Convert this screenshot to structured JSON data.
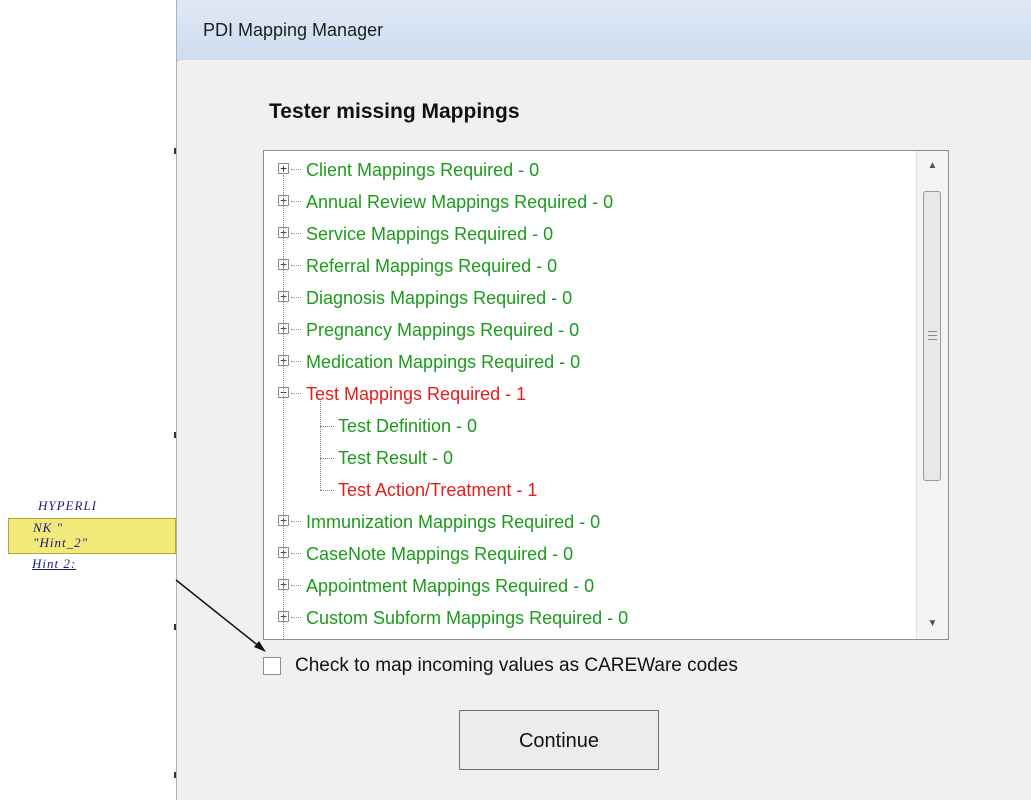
{
  "window": {
    "title": "PDI Mapping Manager"
  },
  "heading": "Tester missing Mappings",
  "tree": {
    "items": [
      {
        "label": "Client Mappings Required - 0",
        "color": "green",
        "expanded": false,
        "toggle": "+"
      },
      {
        "label": "Annual Review Mappings Required - 0",
        "color": "green",
        "expanded": false,
        "toggle": "+"
      },
      {
        "label": "Service Mappings Required - 0",
        "color": "green",
        "expanded": false,
        "toggle": "+"
      },
      {
        "label": "Referral Mappings Required - 0",
        "color": "green",
        "expanded": false,
        "toggle": "+"
      },
      {
        "label": "Diagnosis Mappings Required - 0",
        "color": "green",
        "expanded": false,
        "toggle": "+"
      },
      {
        "label": "Pregnancy Mappings Required - 0",
        "color": "green",
        "expanded": false,
        "toggle": "+"
      },
      {
        "label": "Medication Mappings Required - 0",
        "color": "green",
        "expanded": false,
        "toggle": "+"
      },
      {
        "label": "Test Mappings Required - 1",
        "color": "red",
        "expanded": true,
        "toggle": "−",
        "children": [
          {
            "label": "Test Definition - 0",
            "color": "green"
          },
          {
            "label": "Test Result - 0",
            "color": "green"
          },
          {
            "label": "Test Action/Treatment - 1",
            "color": "red"
          }
        ]
      },
      {
        "label": "Immunization Mappings Required - 0",
        "color": "green",
        "expanded": false,
        "toggle": "+"
      },
      {
        "label": "CaseNote Mappings Required - 0",
        "color": "green",
        "expanded": false,
        "toggle": "+"
      },
      {
        "label": "Appointment Mappings Required - 0",
        "color": "green",
        "expanded": false,
        "toggle": "+"
      },
      {
        "label": "Custom Subform Mappings Required - 0",
        "color": "green",
        "expanded": false,
        "toggle": "+"
      }
    ],
    "scrollbar": {
      "up_glyph": "▲",
      "down_glyph": "▼"
    }
  },
  "checkbox": {
    "label": "Check to map incoming values as CAREWare codes",
    "checked": false
  },
  "continue_button": {
    "label": "Continue"
  },
  "callout": {
    "line1": "HYPERLI",
    "line2": "NK  \"",
    "line3": "\"Hint_2\"",
    "line4": "Hint 2:"
  },
  "colors": {
    "green": "#1c9a1c",
    "red": "#e21d1d",
    "titlebar": "#cddcee",
    "dialog": "#f0f0f0"
  }
}
